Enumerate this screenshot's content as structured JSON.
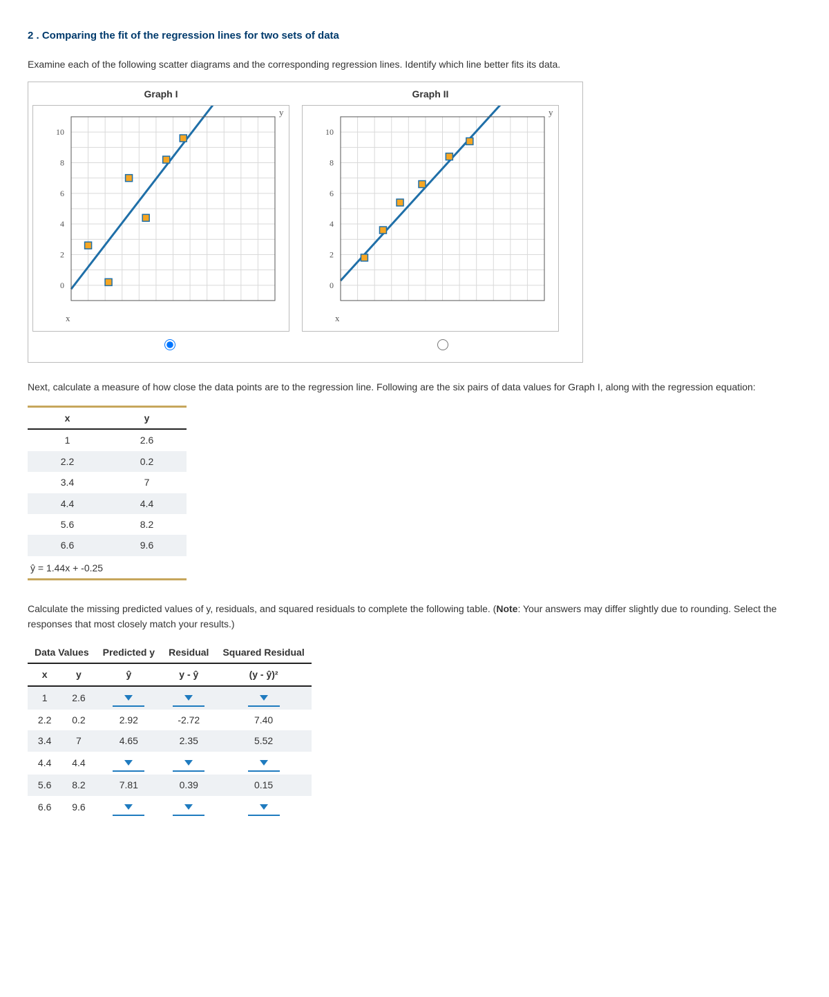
{
  "question": {
    "number_and_title": "2 . Comparing the fit of the regression lines for two sets of data",
    "prompt1": "Examine each of the following scatter diagrams and the corresponding regression lines. Identify which line better fits its data.",
    "prompt2": "Next, calculate a measure of how close the data points are to the regression line. Following are the six pairs of data values for Graph I, along with the regression equation:",
    "prompt3": "Calculate the missing predicted values of y, residuals, and squared residuals to complete the following table. (Note: Your answers may differ slightly due to rounding. Select the responses that most closely match your results.)"
  },
  "graphs": {
    "g1_title": "Graph I",
    "g2_title": "Graph II",
    "axis_y": "y",
    "axis_x": "x",
    "y_ticks": [
      "0",
      "2",
      "4",
      "6",
      "8",
      "10"
    ],
    "selected": "g1"
  },
  "chart_data": [
    {
      "id": "g1",
      "type": "scatter",
      "title": "Graph I",
      "xlabel": "x",
      "ylabel": "y",
      "xlim": [
        0,
        12
      ],
      "ylim": [
        -1,
        11
      ],
      "points": [
        {
          "x": 1.0,
          "y": 2.6
        },
        {
          "x": 2.2,
          "y": 0.2
        },
        {
          "x": 3.4,
          "y": 7.0
        },
        {
          "x": 4.4,
          "y": 4.4
        },
        {
          "x": 5.6,
          "y": 8.2
        },
        {
          "x": 6.6,
          "y": 9.6
        }
      ],
      "regression": {
        "slope": 1.44,
        "intercept": -0.25
      }
    },
    {
      "id": "g2",
      "type": "scatter",
      "title": "Graph II",
      "xlabel": "x",
      "ylabel": "y",
      "xlim": [
        0,
        12
      ],
      "ylim": [
        -1,
        11
      ],
      "points": [
        {
          "x": 1.4,
          "y": 1.8
        },
        {
          "x": 2.5,
          "y": 3.6
        },
        {
          "x": 3.5,
          "y": 5.4
        },
        {
          "x": 4.8,
          "y": 6.6
        },
        {
          "x": 6.4,
          "y": 8.4
        },
        {
          "x": 7.6,
          "y": 9.4
        }
      ],
      "regression": {
        "slope": 1.22,
        "intercept": 0.3
      }
    }
  ],
  "data_table": {
    "head_x": "x",
    "head_y": "y",
    "rows": [
      {
        "x": "1",
        "y": "2.6"
      },
      {
        "x": "2.2",
        "y": "0.2"
      },
      {
        "x": "3.4",
        "y": "7"
      },
      {
        "x": "4.4",
        "y": "4.4"
      },
      {
        "x": "5.6",
        "y": "8.2"
      },
      {
        "x": "6.6",
        "y": "9.6"
      }
    ],
    "equation": "ŷ = 1.44x + -0.25"
  },
  "residual_table": {
    "group_headers": {
      "dv": "Data Values",
      "py": "Predicted y",
      "res": "Residual",
      "sq": "Squared Residual"
    },
    "sub_headers": {
      "x": "x",
      "y": "y",
      "yhat": "ŷ",
      "diff": "y - ŷ",
      "sq": "(y - ŷ)²"
    },
    "rows": [
      {
        "x": "1",
        "y": "2.6",
        "yhat": "",
        "diff": "",
        "sq": ""
      },
      {
        "x": "2.2",
        "y": "0.2",
        "yhat": "2.92",
        "diff": "-2.72",
        "sq": "7.40"
      },
      {
        "x": "3.4",
        "y": "7",
        "yhat": "4.65",
        "diff": "2.35",
        "sq": "5.52"
      },
      {
        "x": "4.4",
        "y": "4.4",
        "yhat": "",
        "diff": "",
        "sq": ""
      },
      {
        "x": "5.6",
        "y": "8.2",
        "yhat": "7.81",
        "diff": "0.39",
        "sq": "0.15"
      },
      {
        "x": "6.6",
        "y": "9.6",
        "yhat": "",
        "diff": "",
        "sq": ""
      }
    ]
  }
}
